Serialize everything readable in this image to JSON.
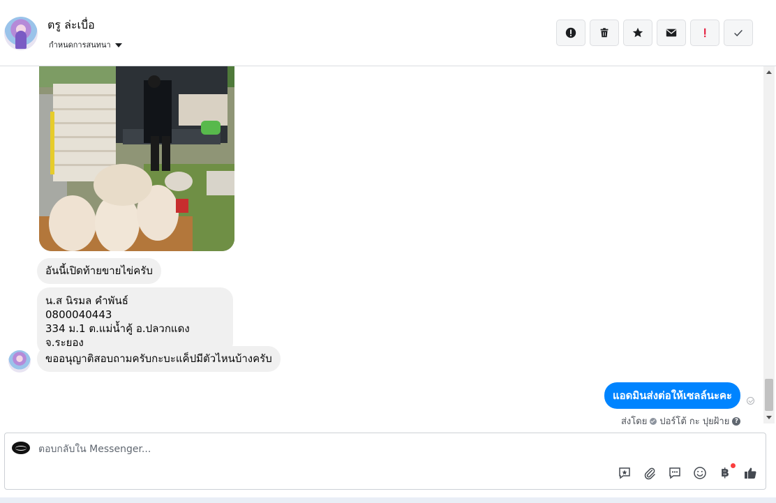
{
  "header": {
    "contact_name": "ตรู ล่ะเบื่อ",
    "convo_label": "กำหนดการสนทนา",
    "actions": [
      {
        "name": "spam-report",
        "icon": "exclamation-circle-icon"
      },
      {
        "name": "delete",
        "icon": "trash-icon"
      },
      {
        "name": "star",
        "icon": "star-icon"
      },
      {
        "name": "mark-unread",
        "icon": "envelope-icon"
      },
      {
        "name": "priority",
        "icon": "red-exclamation-icon"
      },
      {
        "name": "done",
        "icon": "check-icon"
      }
    ]
  },
  "messages": {
    "m1": "อันนี้เปิดท้ายขายไข่ครับ",
    "m2_lines": [
      "น.ส นิรมล คำพันธ์",
      "0800040443",
      "334 ม.1 ต.แม่น้ำคู้ อ.ปลวกแดง จ.ระยอง"
    ],
    "m3": "ขออนุญาติสอบถามครับกะบะแค็ปมีตัวไหนบ้างครับ",
    "outgoing": "แอดมินส่งต่อให้เซลล์นะคะ"
  },
  "sent_by": {
    "prefix": "ส่งโดย",
    "name": "ปอร์โต้ กะ ปุยฝ้าย"
  },
  "composer": {
    "placeholder": "ตอบกลับใน Messenger...",
    "baht_symbol": "฿"
  },
  "colors": {
    "accent": "#0084ff",
    "incoming_bubble": "#f0f0f0",
    "priority_red": "#e41e3f"
  }
}
